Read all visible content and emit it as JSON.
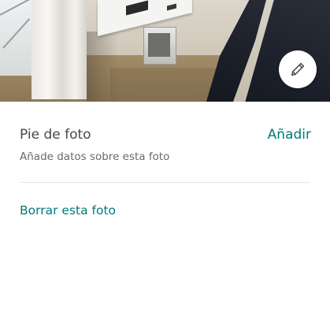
{
  "photo": {
    "icon": "pencil-icon"
  },
  "caption": {
    "title": "Pie de foto",
    "add_label": "Añadir",
    "hint": "Añade datos sobre esta foto"
  },
  "actions": {
    "delete_label": "Borrar esta foto"
  },
  "colors": {
    "accent": "#00797b",
    "title_text": "#484848",
    "secondary_text": "#6a6a6a",
    "divider": "#e4e4e4"
  }
}
